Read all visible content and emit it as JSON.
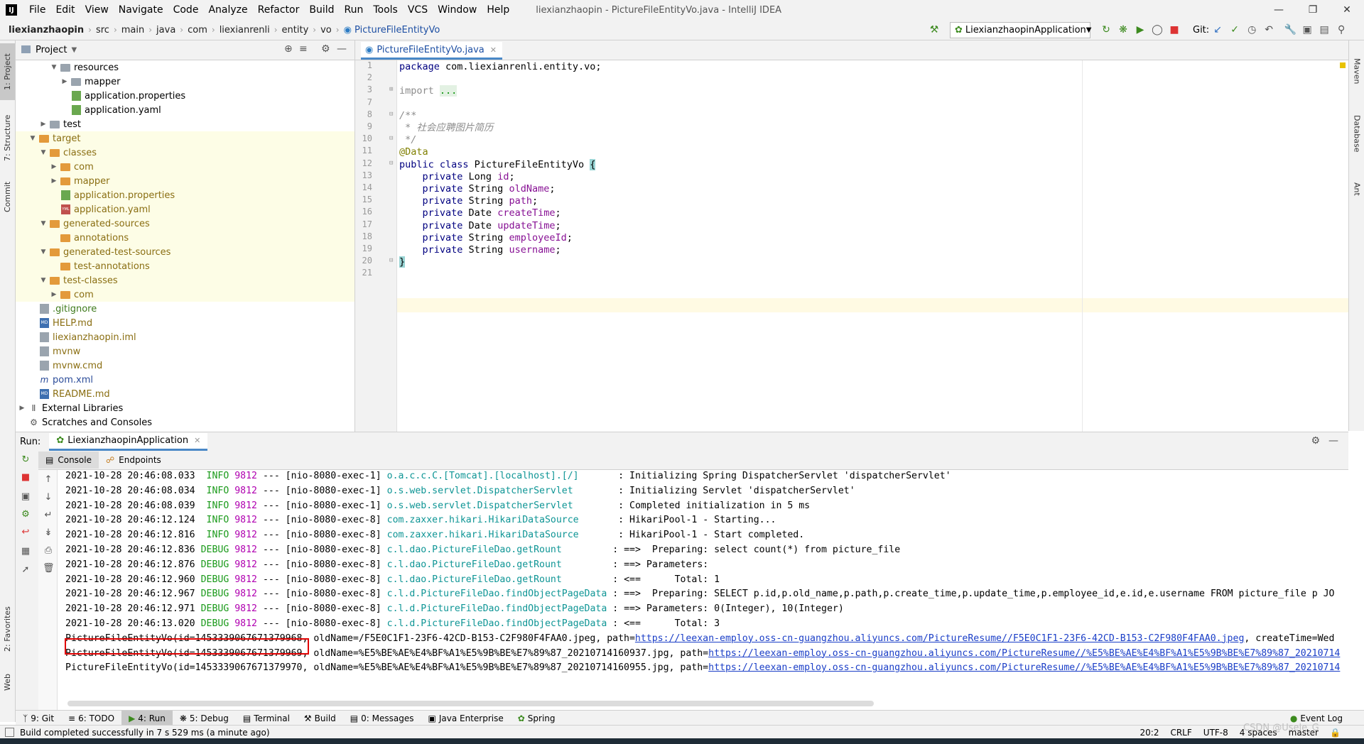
{
  "app": {
    "window_title": "liexianzhaopin - PictureFileEntityVo.java - IntelliJ IDEA",
    "menu": [
      "File",
      "Edit",
      "View",
      "Navigate",
      "Code",
      "Analyze",
      "Refactor",
      "Build",
      "Run",
      "Tools",
      "VCS",
      "Window",
      "Help"
    ]
  },
  "breadcrumb": [
    "liexianzhaopin",
    "src",
    "main",
    "java",
    "com",
    "liexianrenli",
    "entity",
    "vo",
    "PictureFileEntityVo"
  ],
  "toolbar": {
    "run_config": "LiexianzhaopinApplication",
    "git_label": "Git:"
  },
  "left_strip": {
    "project": "1: Project",
    "structure": "7: Structure",
    "commit": "Commit",
    "favorites": "2: Favorites",
    "web": "Web"
  },
  "right_strip": {
    "maven": "Maven",
    "database": "Database",
    "ant": "Ant"
  },
  "project_panel": {
    "title": "Project",
    "tree": [
      {
        "label": "resources",
        "type": "folder-gray",
        "indent": 3,
        "arrow": "open",
        "hl": false
      },
      {
        "label": "mapper",
        "type": "folder-gray",
        "indent": 4,
        "arrow": "closed",
        "hl": false
      },
      {
        "label": "application.properties",
        "type": "file-green",
        "indent": 4,
        "arrow": "",
        "hl": false
      },
      {
        "label": "application.yaml",
        "type": "file-green",
        "indent": 4,
        "arrow": "",
        "hl": false
      },
      {
        "label": "test",
        "type": "folder-gray",
        "indent": 2,
        "arrow": "closed",
        "hl": false
      },
      {
        "label": "target",
        "type": "folder-orange",
        "indent": 1,
        "arrow": "open",
        "hl": true,
        "color": "olive"
      },
      {
        "label": "classes",
        "type": "folder-orange",
        "indent": 2,
        "arrow": "open",
        "hl": true,
        "color": "olive"
      },
      {
        "label": "com",
        "type": "folder-orange",
        "indent": 3,
        "arrow": "closed",
        "hl": true,
        "color": "olive"
      },
      {
        "label": "mapper",
        "type": "folder-orange",
        "indent": 3,
        "arrow": "closed",
        "hl": true,
        "color": "olive"
      },
      {
        "label": "application.properties",
        "type": "file-green",
        "indent": 3,
        "arrow": "",
        "hl": true,
        "color": "olive"
      },
      {
        "label": "application.yaml",
        "type": "file-yml",
        "indent": 3,
        "arrow": "",
        "hl": true,
        "color": "olive"
      },
      {
        "label": "generated-sources",
        "type": "folder-orange",
        "indent": 2,
        "arrow": "open",
        "hl": true,
        "color": "olive"
      },
      {
        "label": "annotations",
        "type": "folder-orange",
        "indent": 3,
        "arrow": "",
        "hl": true,
        "color": "olive"
      },
      {
        "label": "generated-test-sources",
        "type": "folder-orange",
        "indent": 2,
        "arrow": "open",
        "hl": true,
        "color": "olive"
      },
      {
        "label": "test-annotations",
        "type": "folder-orange",
        "indent": 3,
        "arrow": "",
        "hl": true,
        "color": "olive"
      },
      {
        "label": "test-classes",
        "type": "folder-orange",
        "indent": 2,
        "arrow": "open",
        "hl": true,
        "color": "olive"
      },
      {
        "label": "com",
        "type": "folder-orange",
        "indent": 3,
        "arrow": "closed",
        "hl": true,
        "color": "olive"
      },
      {
        "label": ".gitignore",
        "type": "file-gray",
        "indent": 1,
        "arrow": "",
        "hl": false,
        "color": "green"
      },
      {
        "label": "HELP.md",
        "type": "file-md",
        "indent": 1,
        "arrow": "",
        "hl": false,
        "color": "olive"
      },
      {
        "label": "liexianzhaopin.iml",
        "type": "file-gray",
        "indent": 1,
        "arrow": "",
        "hl": false,
        "color": "olive"
      },
      {
        "label": "mvnw",
        "type": "file-gray",
        "indent": 1,
        "arrow": "",
        "hl": false,
        "color": "olive"
      },
      {
        "label": "mvnw.cmd",
        "type": "file-gray",
        "indent": 1,
        "arrow": "",
        "hl": false,
        "color": "olive"
      },
      {
        "label": "pom.xml",
        "type": "file-m",
        "indent": 1,
        "arrow": "",
        "hl": false,
        "color": "blue"
      },
      {
        "label": "README.md",
        "type": "file-md",
        "indent": 1,
        "arrow": "",
        "hl": false,
        "color": "olive"
      },
      {
        "label": "External Libraries",
        "type": "lib",
        "indent": 0,
        "arrow": "closed",
        "hl": false
      },
      {
        "label": "Scratches and Consoles",
        "type": "scratch",
        "indent": 0,
        "arrow": "",
        "hl": false
      }
    ]
  },
  "editor": {
    "tab_label": "PictureFileEntityVo.java",
    "line_numbers": [
      "1",
      "2",
      "3",
      "7",
      "8",
      "9",
      "10",
      "11",
      "12",
      "13",
      "14",
      "15",
      "16",
      "17",
      "18",
      "19",
      "20",
      "21"
    ],
    "lines": [
      [
        {
          "t": "package ",
          "c": "kw"
        },
        {
          "t": "com.liexianrenli.entity.vo;",
          "c": ""
        }
      ],
      [],
      [
        {
          "t": "import ",
          "c": "cm2"
        },
        {
          "t": "...",
          "c": "fold"
        }
      ],
      [],
      [
        {
          "t": "/**",
          "c": "cm"
        }
      ],
      [
        {
          "t": " * 社会应聘图片简历",
          "c": "cm"
        }
      ],
      [
        {
          "t": " */",
          "c": "cm"
        }
      ],
      [
        {
          "t": "@Data",
          "c": "an"
        }
      ],
      [
        {
          "t": "public class ",
          "c": "kw"
        },
        {
          "t": "PictureFileEntityVo ",
          "c": ""
        },
        {
          "t": "{",
          "c": "brace"
        }
      ],
      [
        {
          "t": "    private ",
          "c": "kw"
        },
        {
          "t": "Long ",
          "c": ""
        },
        {
          "t": "id",
          "c": "fd"
        },
        {
          "t": ";",
          "c": ""
        }
      ],
      [
        {
          "t": "    private ",
          "c": "kw"
        },
        {
          "t": "String ",
          "c": ""
        },
        {
          "t": "oldName",
          "c": "fd"
        },
        {
          "t": ";",
          "c": ""
        }
      ],
      [
        {
          "t": "    private ",
          "c": "kw"
        },
        {
          "t": "String ",
          "c": ""
        },
        {
          "t": "path",
          "c": "fd"
        },
        {
          "t": ";",
          "c": ""
        }
      ],
      [
        {
          "t": "    private ",
          "c": "kw"
        },
        {
          "t": "Date ",
          "c": ""
        },
        {
          "t": "createTime",
          "c": "fd"
        },
        {
          "t": ";",
          "c": ""
        }
      ],
      [
        {
          "t": "    private ",
          "c": "kw"
        },
        {
          "t": "Date ",
          "c": ""
        },
        {
          "t": "updateTime",
          "c": "fd"
        },
        {
          "t": ";",
          "c": ""
        }
      ],
      [
        {
          "t": "    private ",
          "c": "kw"
        },
        {
          "t": "String ",
          "c": ""
        },
        {
          "t": "employeeId",
          "c": "fd"
        },
        {
          "t": ";",
          "c": ""
        }
      ],
      [
        {
          "t": "    private ",
          "c": "kw"
        },
        {
          "t": "String ",
          "c": ""
        },
        {
          "t": "username",
          "c": "fd"
        },
        {
          "t": ";",
          "c": ""
        }
      ],
      [
        {
          "t": "}",
          "c": "brace"
        }
      ],
      []
    ]
  },
  "run_panel": {
    "run_label": "Run:",
    "run_tab": "LiexianzhaopinApplication",
    "console_tab": "Console",
    "endpoints_tab": "Endpoints",
    "log": [
      {
        "ts": "2021-10-28 20:46:08.033",
        "lv": " INFO",
        "pid": "9812",
        "th": "--- [nio-8080-exec-1]",
        "lg": "o.a.c.c.C.[Tomcat].[localhost].[/]      ",
        "msg": " : Initializing Spring DispatcherServlet 'dispatcherServlet'"
      },
      {
        "ts": "2021-10-28 20:46:08.034",
        "lv": " INFO",
        "pid": "9812",
        "th": "--- [nio-8080-exec-1]",
        "lg": "o.s.web.servlet.DispatcherServlet       ",
        "msg": " : Initializing Servlet 'dispatcherServlet'"
      },
      {
        "ts": "2021-10-28 20:46:08.039",
        "lv": " INFO",
        "pid": "9812",
        "th": "--- [nio-8080-exec-1]",
        "lg": "o.s.web.servlet.DispatcherServlet       ",
        "msg": " : Completed initialization in 5 ms"
      },
      {
        "ts": "2021-10-28 20:46:12.124",
        "lv": " INFO",
        "pid": "9812",
        "th": "--- [nio-8080-exec-8]",
        "lg": "com.zaxxer.hikari.HikariDataSource      ",
        "msg": " : HikariPool-1 - Starting..."
      },
      {
        "ts": "2021-10-28 20:46:12.816",
        "lv": " INFO",
        "pid": "9812",
        "th": "--- [nio-8080-exec-8]",
        "lg": "com.zaxxer.hikari.HikariDataSource      ",
        "msg": " : HikariPool-1 - Start completed."
      },
      {
        "ts": "2021-10-28 20:46:12.836",
        "lv": "DEBUG",
        "pid": "9812",
        "th": "--- [nio-8080-exec-8]",
        "lg": "c.l.dao.PictureFileDao.getRount        ",
        "msg": " : ==>  Preparing: select count(*) from picture_file"
      },
      {
        "ts": "2021-10-28 20:46:12.876",
        "lv": "DEBUG",
        "pid": "9812",
        "th": "--- [nio-8080-exec-8]",
        "lg": "c.l.dao.PictureFileDao.getRount        ",
        "msg": " : ==> Parameters: "
      },
      {
        "ts": "2021-10-28 20:46:12.960",
        "lv": "DEBUG",
        "pid": "9812",
        "th": "--- [nio-8080-exec-8]",
        "lg": "c.l.dao.PictureFileDao.getRount        ",
        "msg": " : <==      Total: 1"
      },
      {
        "ts": "2021-10-28 20:46:12.967",
        "lv": "DEBUG",
        "pid": "9812",
        "th": "--- [nio-8080-exec-8]",
        "lg": "c.l.d.PictureFileDao.findObjectPageData",
        "msg": " : ==>  Preparing: SELECT p.id,p.old_name,p.path,p.create_time,p.update_time,p.employee_id,e.id,e.username FROM picture_file p JO"
      },
      {
        "ts": "2021-10-28 20:46:12.971",
        "lv": "DEBUG",
        "pid": "9812",
        "th": "--- [nio-8080-exec-8]",
        "lg": "c.l.d.PictureFileDao.findObjectPageData",
        "msg": " : ==> Parameters: 0(Integer), 10(Integer)"
      },
      {
        "ts": "2021-10-28 20:46:13.020",
        "lv": "DEBUG",
        "pid": "9812",
        "th": "--- [nio-8080-exec-8]",
        "lg": "c.l.d.PictureFileDao.findObjectPageData",
        "msg": " : <==      Total: 3"
      }
    ],
    "results": [
      {
        "pre": "PictureFileEntityVo(id=1453339067671379968,",
        "mid": " oldName=/F5E0C1F1-23F6-42CD-B153-C2F980F4FAA0.jpeg, path=",
        "url": "https://leexan-employ.oss-cn-guangzhou.aliyuncs.com/PictureResume//F5E0C1F1-23F6-42CD-B153-C2F980F4FAA0.jpeg",
        "post": ", createTime=Wed"
      },
      {
        "pre": "PictureFileEntityVo(id=1453339067671379969,",
        "mid": " oldName=%E5%BE%AE%E4%BF%A1%E5%9B%BE%E7%89%87_20210714160937.jpg, path=",
        "url": "https://leexan-employ.oss-cn-guangzhou.aliyuncs.com/PictureResume//%E5%BE%AE%E4%BF%A1%E5%9B%BE%E7%89%87_20210714",
        "post": ""
      },
      {
        "pre": "PictureFileEntityVo(id=1453339067671379970,",
        "mid": " oldName=%E5%BE%AE%E4%BF%A1%E5%9B%BE%E7%89%87_20210714160955.jpg, path=",
        "url": "https://leexan-employ.oss-cn-guangzhou.aliyuncs.com/PictureResume//%E5%BE%AE%E4%BF%A1%E5%9B%BE%E7%89%87_20210714",
        "post": ""
      }
    ]
  },
  "bottom_tools": {
    "git": "9: Git",
    "todo": "6: TODO",
    "run": "4: Run",
    "debug": "5: Debug",
    "terminal": "Terminal",
    "build": "Build",
    "messages": "0: Messages",
    "java_enterprise": "Java Enterprise",
    "spring": "Spring",
    "event_log": "Event Log"
  },
  "status": {
    "message": "Build completed successfully in 7 s 529 ms (a minute ago)",
    "position": "20:2",
    "line_sep": "CRLF",
    "encoding": "UTF-8",
    "indent": "4 spaces",
    "branch": "master"
  },
  "watermark": "CSDN @Usele_G"
}
